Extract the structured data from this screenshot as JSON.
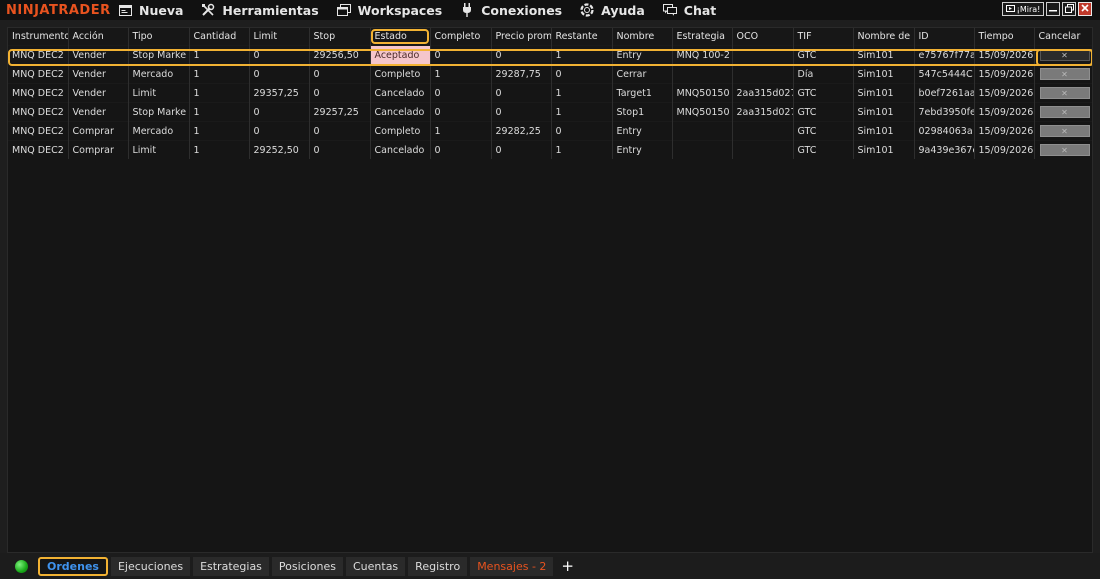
{
  "app": {
    "logo": "NINJATRADER"
  },
  "menu": {
    "items": [
      {
        "key": "nueva",
        "label": "Nueva",
        "icon": "new-window-icon"
      },
      {
        "key": "herramientas",
        "label": "Herramientas",
        "icon": "tools-icon"
      },
      {
        "key": "workspaces",
        "label": "Workspaces",
        "icon": "workspaces-icon"
      },
      {
        "key": "conexiones",
        "label": "Conexiones",
        "icon": "plug-icon"
      },
      {
        "key": "ayuda",
        "label": "Ayuda",
        "icon": "help-lifebuoy-icon"
      },
      {
        "key": "chat",
        "label": "Chat",
        "icon": "chat-icon"
      }
    ],
    "window_controls": {
      "mira": "¡Mira!"
    }
  },
  "orders": {
    "columns": [
      "Instrumento",
      "Acción",
      "Tipo",
      "Cantidad",
      "Limit",
      "Stop",
      "Estado",
      "Completo",
      "Precio prom",
      "Restante",
      "Nombre",
      "Estrategia",
      "OCO",
      "TIF",
      "Nombre de",
      "ID",
      "Tiempo",
      "Cancelar"
    ],
    "cancel_glyph": "✕",
    "rows": [
      [
        "MNQ DEC2",
        "Vender",
        "Stop Marke",
        "1",
        "0",
        "29256,50",
        "Aceptado",
        "0",
        "0",
        "1",
        "Entry",
        "MNQ 100-2",
        "",
        "GTC",
        "Sim101",
        "e75767f77a",
        "15/09/2026"
      ],
      [
        "MNQ DEC2",
        "Vender",
        "Mercado",
        "1",
        "0",
        "0",
        "Completo",
        "1",
        "29287,75",
        "0",
        "Cerrar",
        "",
        "",
        "Día",
        "Sim101",
        "547c5444C",
        "15/09/2026"
      ],
      [
        "MNQ DEC2",
        "Vender",
        "Limit",
        "1",
        "29357,25",
        "0",
        "Cancelado",
        "0",
        "0",
        "1",
        "Target1",
        "MNQ50150",
        "2aa315d027",
        "GTC",
        "Sim101",
        "b0ef7261aa",
        "15/09/2026"
      ],
      [
        "MNQ DEC2",
        "Vender",
        "Stop Marke",
        "1",
        "0",
        "29257,25",
        "Cancelado",
        "0",
        "0",
        "1",
        "Stop1",
        "MNQ50150",
        "2aa315d027",
        "GTC",
        "Sim101",
        "7ebd3950fe",
        "15/09/2026"
      ],
      [
        "MNQ DEC2",
        "Comprar",
        "Mercado",
        "1",
        "0",
        "0",
        "Completo",
        "1",
        "29282,25",
        "0",
        "Entry",
        "",
        "",
        "GTC",
        "Sim101",
        "02984063a",
        "15/09/2026"
      ],
      [
        "MNQ DEC2",
        "Comprar",
        "Limit",
        "1",
        "29252,50",
        "0",
        "Cancelado",
        "0",
        "0",
        "1",
        "Entry",
        "",
        "",
        "GTC",
        "Sim101",
        "9a439e367e",
        "15/09/2026"
      ]
    ],
    "accepted_status": "Aceptado"
  },
  "tabs": {
    "items": [
      {
        "label": "Ordenes",
        "active": true,
        "variant": "normal"
      },
      {
        "label": "Ejecuciones",
        "active": false,
        "variant": "normal"
      },
      {
        "label": "Estrategias",
        "active": false,
        "variant": "normal"
      },
      {
        "label": "Posiciones",
        "active": false,
        "variant": "normal"
      },
      {
        "label": "Cuentas",
        "active": false,
        "variant": "normal"
      },
      {
        "label": "Registro",
        "active": false,
        "variant": "normal"
      },
      {
        "label": "Mensajes - 2",
        "active": false,
        "variant": "messages"
      }
    ],
    "add_label": "+"
  },
  "colors": {
    "logo": "#e8531f",
    "accent_highlight": "#f2b233",
    "active_tab_text": "#3f93ee",
    "messages_tab_text": "#e8531f",
    "accepted_bg": "#f5c6cb",
    "status_ok": "#18a818"
  }
}
